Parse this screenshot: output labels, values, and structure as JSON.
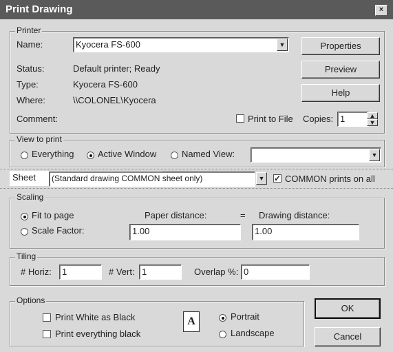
{
  "title": "Print Drawing",
  "close": "×",
  "printer": {
    "legend": "Printer",
    "name_label": "Name:",
    "name_value": "Kyocera FS-600",
    "status_label": "Status:",
    "status_value": "Default printer; Ready",
    "type_label": "Type:",
    "type_value": "Kyocera FS-600",
    "where_label": "Where:",
    "where_value": "\\\\COLONEL\\Kyocera",
    "comment_label": "Comment:",
    "print_to_file": "Print to File",
    "copies_label": "Copies:",
    "copies_value": "1",
    "properties": "Properties",
    "preview": "Preview",
    "help": "Help"
  },
  "view": {
    "legend": "View to print",
    "everything": "Everything",
    "active_window": "Active Window",
    "named_view": "Named View:",
    "named_view_value": ""
  },
  "sheet": {
    "label": "Sheet",
    "value": "(Standard drawing  COMMON sheet only)",
    "common_label": "COMMON prints on all"
  },
  "scaling": {
    "legend": "Scaling",
    "fit_to_page": "Fit to page",
    "scale_factor": "Scale Factor:",
    "paper_distance_label": "Paper distance:",
    "equals": "=",
    "drawing_distance_label": "Drawing distance:",
    "paper_distance": "1.00",
    "drawing_distance": "1.00"
  },
  "tiling": {
    "legend": "Tiling",
    "horiz_label": "# Horiz:",
    "horiz_value": "1",
    "vert_label": "# Vert:",
    "vert_value": "1",
    "overlap_label": "Overlap %:",
    "overlap_value": "0"
  },
  "options": {
    "legend": "Options",
    "print_white_as_black": "Print White as Black",
    "print_everything_black": "Print everything black",
    "portrait_icon_letter": "A",
    "portrait": "Portrait",
    "landscape": "Landscape"
  },
  "ok": "OK",
  "cancel": "Cancel"
}
